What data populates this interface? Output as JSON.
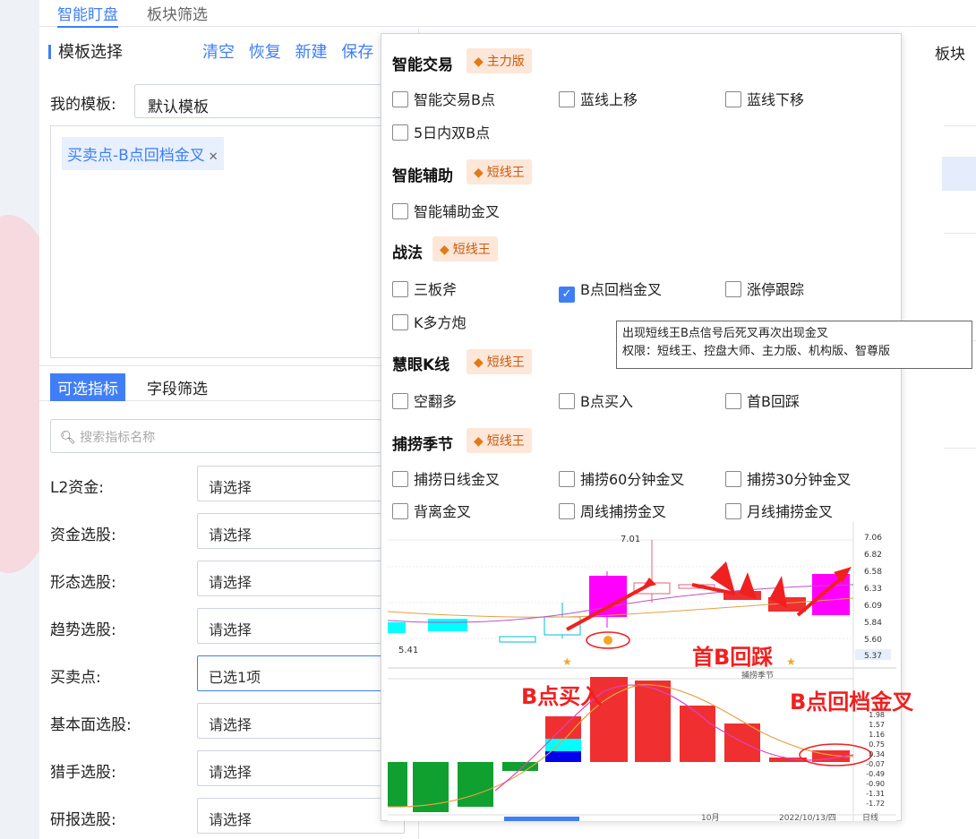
{
  "top_tabs": [
    "智能盯盘",
    "板块筛选"
  ],
  "left": {
    "title": "模板选择",
    "actions": [
      "清空",
      "恢复",
      "新建",
      "保存"
    ],
    "actions_icon": "copy-icon",
    "template_label": "我的模板:",
    "template_value": "默认模板",
    "selected_tag": "买卖点-B点回档金叉",
    "tabs": [
      "可选指标",
      "字段筛选"
    ],
    "search_placeholder": "搜索指标名称",
    "filters": [
      {
        "label": "L2资金:",
        "value": "请选择"
      },
      {
        "label": "资金选股:",
        "value": "请选择"
      },
      {
        "label": "形态选股:",
        "value": "请选择"
      },
      {
        "label": "趋势选股:",
        "value": "请选择"
      },
      {
        "label": "买卖点:",
        "value": "已选1项"
      },
      {
        "label": "基本面选股:",
        "value": "请选择"
      },
      {
        "label": "猎手选股:",
        "value": "请选择"
      },
      {
        "label": "研报选股:",
        "value": "请选择"
      }
    ]
  },
  "right_label": "板块",
  "popup": {
    "sections": [
      {
        "title": "智能交易",
        "badge": "主力版",
        "items": [
          "智能交易B点",
          "蓝线上移",
          "蓝线下移",
          "5日内双B点"
        ]
      },
      {
        "title": "智能辅助",
        "badge": "短线王",
        "items": [
          "智能辅助金叉"
        ]
      },
      {
        "title": "战法",
        "badge": "短线王",
        "items": [
          "三板斧",
          "B点回档金叉",
          "涨停跟踪",
          "K多方炮"
        ]
      },
      {
        "title": "慧眼K线",
        "badge": "短线王",
        "items": [
          "空翻多",
          "B点买入",
          "首B回踩"
        ]
      },
      {
        "title": "捕捞季节",
        "badge": "短线王",
        "items": [
          "捕捞日线金叉",
          "捕捞60分钟金叉",
          "捕捞30分钟金叉",
          "背离金叉",
          "周线捕捞金叉",
          "月线捕捞金叉"
        ]
      }
    ],
    "checked": "B点回档金叉",
    "tooltip_line1": "出现短线王B点信号后死叉再次出现金叉",
    "tooltip_line2": "权限：短线王、控盘大师、主力版、机构版、智尊版"
  },
  "chart": {
    "price_axis": [
      "7.06",
      "6.82",
      "6.58",
      "6.33",
      "6.09",
      "5.84",
      "5.60",
      "5.37"
    ],
    "high_label": "7.01",
    "low_label": "5.41",
    "indicator_axis": [
      "1.98",
      "1.57",
      "1.16",
      "0.75",
      "0.34",
      "-0.07",
      "-0.49",
      "-0.90",
      "-1.31",
      "-1.72"
    ],
    "indicator_title": "捕捞季节",
    "date_label": "2022/10/13/四",
    "month_label": "10月",
    "period_label": "日线",
    "annotations": [
      "首B回踩",
      "B点买入",
      "B点回档金叉"
    ],
    "colors": {
      "up": "#ff00ff",
      "down": "#00ffff",
      "red": "#f03030",
      "green": "#10a030"
    }
  }
}
